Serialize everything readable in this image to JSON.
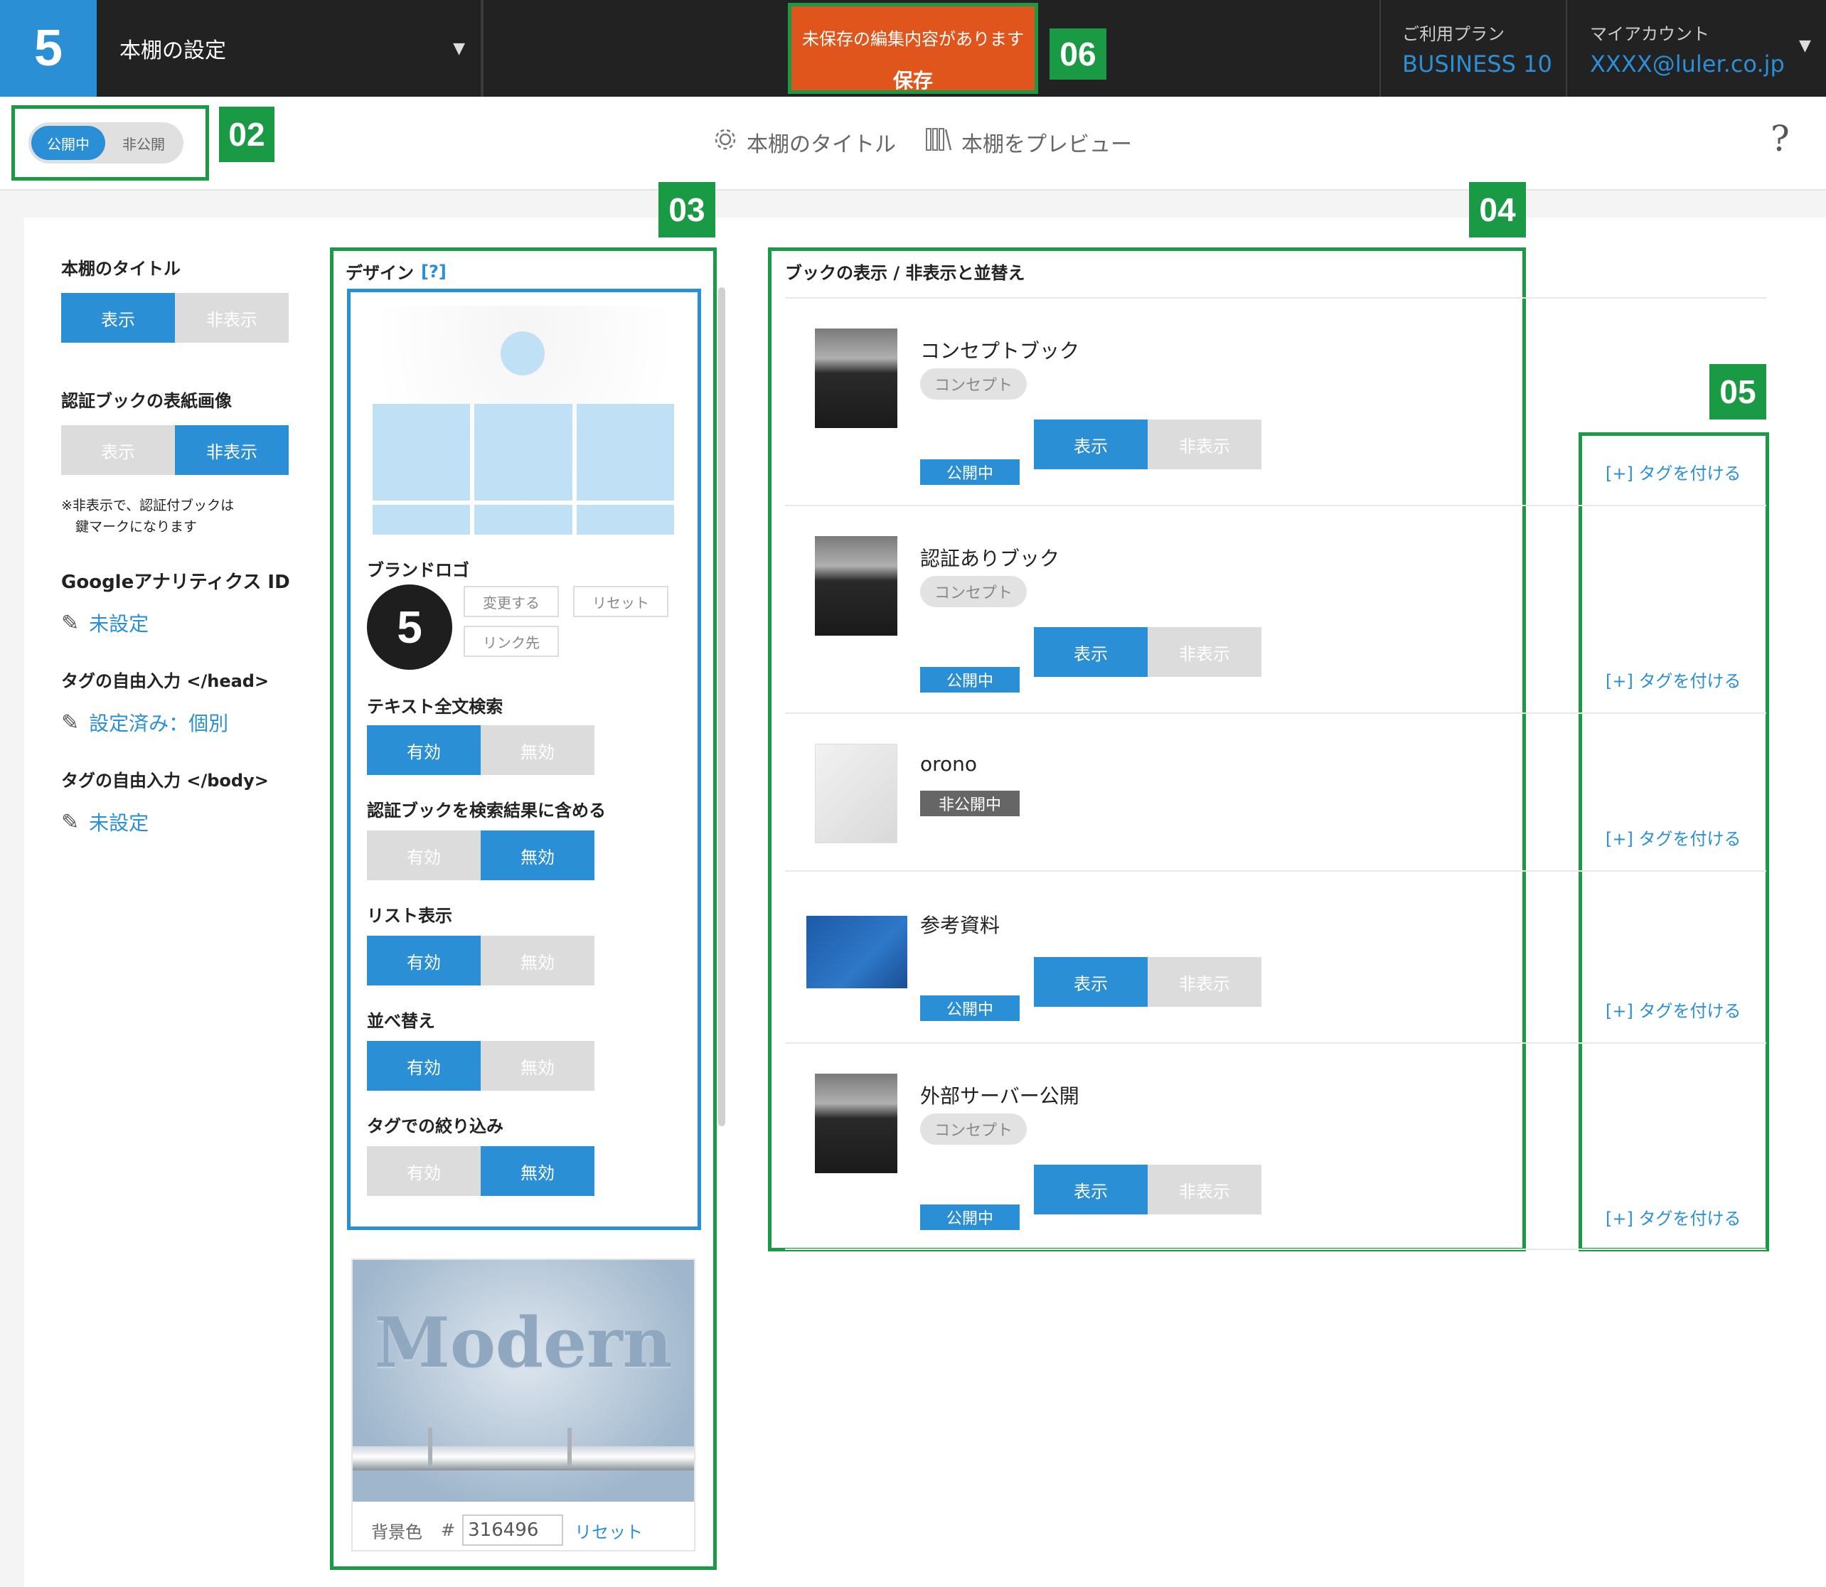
{
  "header": {
    "logo_digit": "5",
    "shelf_title": "本棚の設定",
    "unsaved_text": "未保存の編集内容があります",
    "save_label": "保存",
    "plan_label": "ご利用プラン",
    "plan_value": "BUSINESS 10",
    "account_label": "マイアカウント",
    "account_value": "XXXX@luler.co.jp"
  },
  "callouts": {
    "c02": "02",
    "c03": "03",
    "c04": "04",
    "c05": "05",
    "c06": "06"
  },
  "toolbar": {
    "public_on": "公開中",
    "public_off": "非公開",
    "title_link": "本棚のタイトル",
    "preview_link": "本棚をプレビュー",
    "help": "?"
  },
  "sidebar": {
    "title_heading": "本棚のタイトル",
    "show": "表示",
    "hide": "非表示",
    "cover_heading": "認証ブックの表紙画像",
    "cover_note_1": "※非表示で、認証付ブックは",
    "cover_note_2": "鍵マークになります",
    "ga_heading": "Googleアナリティクス ID",
    "ga_value": "未設定",
    "head_heading": "タグの自由入力 </head>",
    "head_value": "設定済み：個別",
    "body_heading": "タグの自由入力 </body>",
    "body_value": "未設定"
  },
  "design": {
    "heading": "デザイン",
    "help": "[?]",
    "brand_logo": "ブランドロゴ",
    "brand_digit": "5",
    "change": "変更する",
    "reset": "リセット",
    "link_target": "リンク先",
    "fulltext": "テキスト全文検索",
    "include_auth": "認証ブックを検索結果に含める",
    "list_view": "リスト表示",
    "sort": "並べ替え",
    "tag_filter": "タグでの絞り込み",
    "enabled": "有効",
    "disabled": "無効",
    "theme_name": "Modern",
    "bg_color_label": "背景色",
    "hash": "#",
    "bg_color_value": "316496",
    "bg_reset": "リセット"
  },
  "books": {
    "heading": "ブックの表示 / 非表示と並替え",
    "show": "表示",
    "hide": "非表示",
    "tag_link": "[+] タグを付ける",
    "items": [
      {
        "title": "コンセプトブック",
        "tag": "コンセプト",
        "status": "公開中"
      },
      {
        "title": "認証ありブック",
        "tag": "コンセプト",
        "status": "公開中"
      },
      {
        "title": "orono",
        "status": "非公開中"
      },
      {
        "title": "参考資料",
        "status": "公開中"
      },
      {
        "title": "外部サーバー公開",
        "tag": "コンセプト",
        "status": "公開中"
      }
    ]
  }
}
